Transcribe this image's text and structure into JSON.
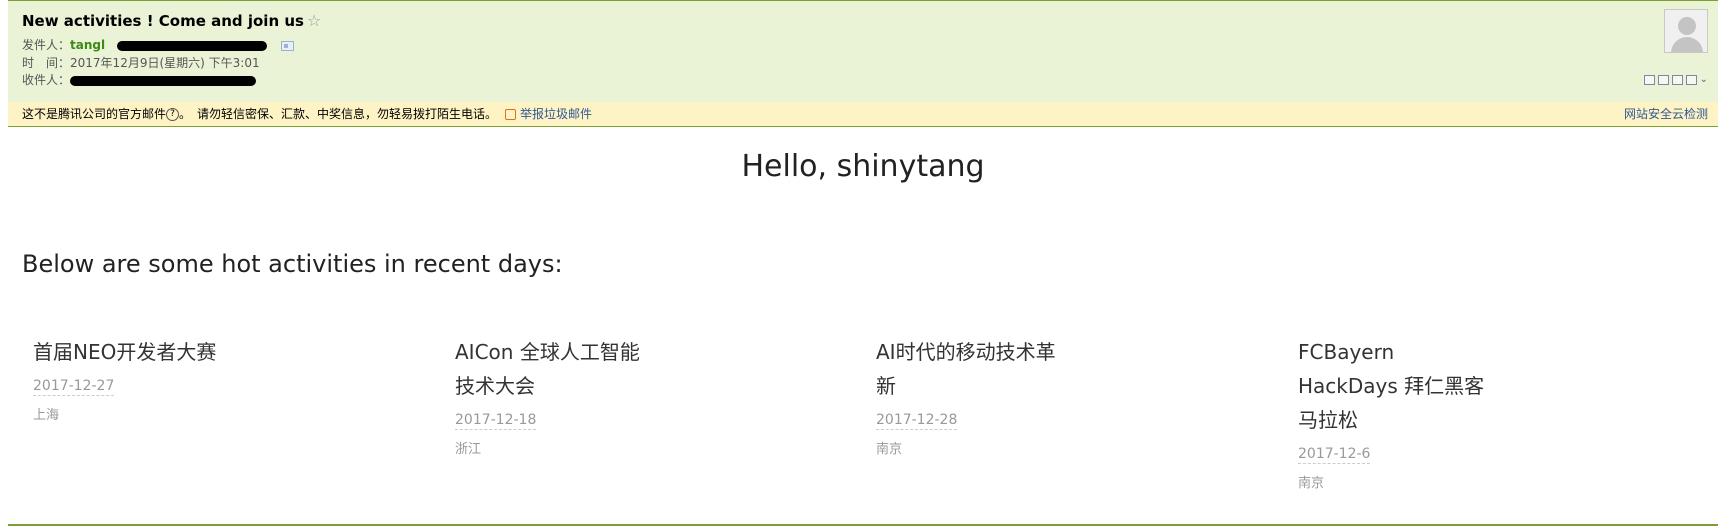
{
  "header": {
    "subject": "New activities ! Come and join us",
    "star_glyph": "☆",
    "from_label": "发件人：",
    "from_name": "tangl",
    "time_label": "时　间：",
    "time_value": "2017年12月9日(星期六) 下午3:01",
    "to_label": "收件人："
  },
  "warning": {
    "notice": "这不是腾讯公司的官方邮件",
    "help_glyph": "?",
    "advice": "。　请勿轻信密保、汇款、中奖信息，勿轻易拨打陌生电话。",
    "report_link": "举报垃圾邮件",
    "cloud_check": "网站安全云检测"
  },
  "content": {
    "greeting": "Hello, shinytang",
    "intro": "Below are some hot activities in recent days:",
    "activities": [
      {
        "title": "首届NEO开发者大赛",
        "date": "2017-12-27",
        "place": "上海"
      },
      {
        "title": "AICon 全球人工智能技术大会",
        "date": "2017-12-18",
        "place": "浙江"
      },
      {
        "title": "AI时代的移动技术革新",
        "date": "2017-12-28",
        "place": "南京"
      },
      {
        "title": "FCBayern HackDays 拜仁黑客马拉松",
        "date": "2017-12-6",
        "place": "南京"
      }
    ]
  },
  "colors": {
    "header_bg": "#ebf3d6",
    "warning_bg": "#fdf3c4",
    "sender_name": "#3c8a17",
    "link": "#2f5896"
  },
  "icons": [
    "star-icon",
    "contact-card-icon",
    "avatar-icon",
    "help-icon",
    "report-icon",
    "window-icon",
    "print-icon",
    "chevron-down-icon"
  ]
}
